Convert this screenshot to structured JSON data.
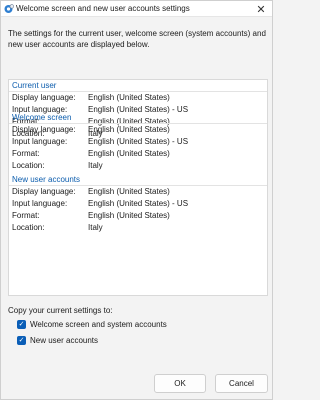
{
  "window": {
    "title": "Welcome screen and new user accounts settings",
    "close_glyph": "✕",
    "icon": "globe-settings-icon"
  },
  "intro_text": "The settings for the current user, welcome screen (system accounts) and new user accounts are displayed below.",
  "sections": [
    {
      "heading": "Current user",
      "rows": [
        {
          "label": "Display language:",
          "value": "English (United States)"
        },
        {
          "label": "Input language:",
          "value": "English (United States) - US"
        },
        {
          "label": "Format:",
          "value": "English (United States)"
        },
        {
          "label": "Location:",
          "value": "Italy"
        }
      ]
    },
    {
      "heading": "Welcome screen",
      "rows": [
        {
          "label": "Display language:",
          "value": "English (United States)"
        },
        {
          "label": "Input language:",
          "value": "English (United States) - US"
        },
        {
          "label": "Format:",
          "value": "English (United States)"
        },
        {
          "label": "Location:",
          "value": "Italy"
        }
      ]
    },
    {
      "heading": "New user accounts",
      "rows": [
        {
          "label": "Display language:",
          "value": "English (United States)"
        },
        {
          "label": "Input language:",
          "value": "English (United States) - US"
        },
        {
          "label": "Format:",
          "value": "English (United States)"
        },
        {
          "label": "Location:",
          "value": "Italy"
        }
      ]
    }
  ],
  "copy": {
    "label": "Copy your current settings to:",
    "options": [
      {
        "label": "Welcome screen and system accounts",
        "checked": true
      },
      {
        "label": "New user accounts",
        "checked": true
      }
    ]
  },
  "buttons": {
    "ok": "OK",
    "cancel": "Cancel"
  },
  "colors": {
    "accent": "#0a5eb7",
    "section_heading": "#0b5cad"
  }
}
